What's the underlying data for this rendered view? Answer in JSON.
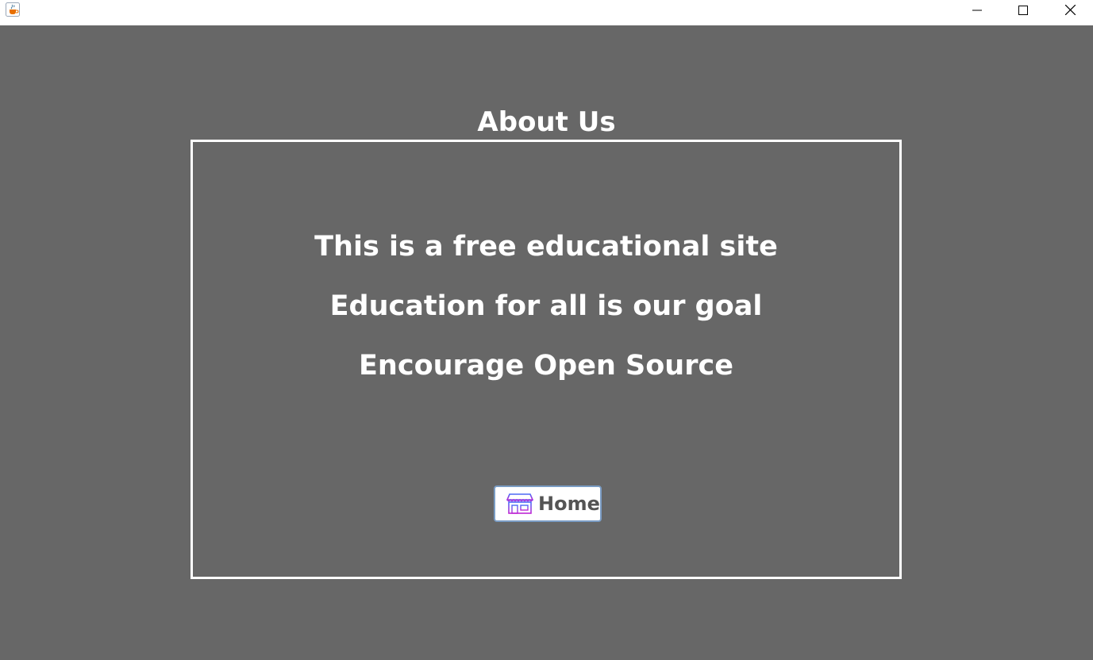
{
  "window": {
    "icons": {
      "app": "java-cup-icon",
      "minimize": "minimize-icon",
      "maximize": "maximize-icon",
      "close": "close-icon"
    }
  },
  "page": {
    "heading": "About Us",
    "lines": [
      "This is a free educational site",
      "Education for all is our goal",
      "Encourage Open Source"
    ],
    "home_button": {
      "label": "Home",
      "icon": "store-icon"
    }
  },
  "colors": {
    "background": "#676767",
    "text": "#ffffff",
    "button_text": "#545454",
    "icon_accent_blue": "#4a6cf7",
    "icon_accent_magenta": "#c026d3"
  }
}
